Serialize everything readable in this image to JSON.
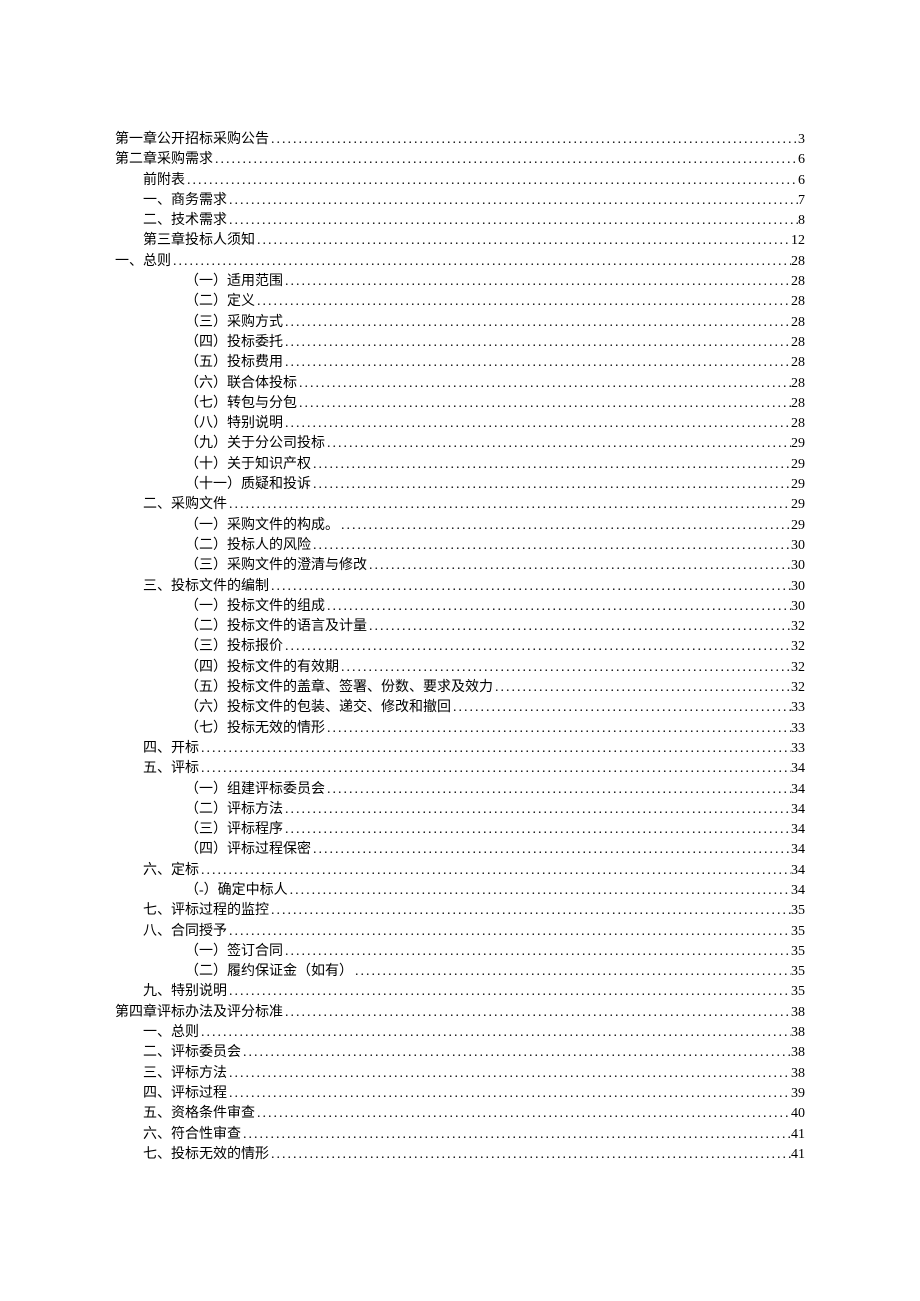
{
  "toc": [
    {
      "label": "第一章公开招标采购公告",
      "page": "3",
      "indent": 0
    },
    {
      "label": "第二章采购需求",
      "page": "6",
      "indent": 0
    },
    {
      "label": "前附表",
      "page": "6",
      "indent": 1
    },
    {
      "label": "一、商务需求",
      "page": "7",
      "indent": 1
    },
    {
      "label": "二、技术需求",
      "page": "8",
      "indent": 1
    },
    {
      "label": "第三章投标人须知",
      "page": "12",
      "indent": 1
    },
    {
      "label": "一、总则",
      "page": "28",
      "indent": 0
    },
    {
      "label": "（一）适用范围",
      "page": "28",
      "indent": 2
    },
    {
      "label": "（二）定义",
      "page": "28",
      "indent": 2
    },
    {
      "label": "（三）采购方式",
      "page": "28",
      "indent": 2
    },
    {
      "label": "（四）投标委托",
      "page": "28",
      "indent": 2
    },
    {
      "label": "（五）投标费用",
      "page": "28",
      "indent": 2
    },
    {
      "label": "（六）联合体投标",
      "page": "28",
      "indent": 2
    },
    {
      "label": "（七）转包与分包",
      "page": "28",
      "indent": 2
    },
    {
      "label": "（八）特别说明",
      "page": "28",
      "indent": 2
    },
    {
      "label": "（九）关于分公司投标",
      "page": "29",
      "indent": 2
    },
    {
      "label": "（十）关于知识产权",
      "page": "29",
      "indent": 2
    },
    {
      "label": "（十一）质疑和投诉",
      "page": "29",
      "indent": 2
    },
    {
      "label": "二、采购文件",
      "page": "29",
      "indent": 1
    },
    {
      "label": "（一）采购文件的构成。",
      "page": "29",
      "indent": 2
    },
    {
      "label": "（二）投标人的风险",
      "page": "30",
      "indent": 2
    },
    {
      "label": "（三）采购文件的澄清与修改",
      "page": "30",
      "indent": 2
    },
    {
      "label": "三、投标文件的编制",
      "page": "30",
      "indent": 1
    },
    {
      "label": "（一）投标文件的组成",
      "page": "30",
      "indent": 2
    },
    {
      "label": "（二）投标文件的语言及计量",
      "page": "32",
      "indent": 2
    },
    {
      "label": "（三）投标报价",
      "page": "32",
      "indent": 2
    },
    {
      "label": "（四）投标文件的有效期",
      "page": "32",
      "indent": 2
    },
    {
      "label": "（五）投标文件的盖章、签署、份数、要求及效力",
      "page": "32",
      "indent": 2
    },
    {
      "label": "（六）投标文件的包装、递交、修改和撤回",
      "page": "33",
      "indent": 2
    },
    {
      "label": "（七）投标无效的情形",
      "page": "33",
      "indent": 2
    },
    {
      "label": "四、开标",
      "page": "33",
      "indent": 1
    },
    {
      "label": "五、评标",
      "page": "34",
      "indent": 1
    },
    {
      "label": "（一）组建评标委员会",
      "page": "34",
      "indent": 2
    },
    {
      "label": "（二）评标方法",
      "page": "34",
      "indent": 2
    },
    {
      "label": "（三）评标程序",
      "page": "34",
      "indent": 2
    },
    {
      "label": "（四）评标过程保密",
      "page": "34",
      "indent": 2
    },
    {
      "label": "六、定标",
      "page": "34",
      "indent": 1
    },
    {
      "label": "（-）确定中标人",
      "page": "34",
      "indent": 2
    },
    {
      "label": "七、评标过程的监控",
      "page": "35",
      "indent": 1
    },
    {
      "label": "八、合同授予",
      "page": "35",
      "indent": 1
    },
    {
      "label": "（一）签订合同",
      "page": "35",
      "indent": 2
    },
    {
      "label": "（二）履约保证金（如有）",
      "page": "35",
      "indent": 2
    },
    {
      "label": "九、特别说明",
      "page": "35",
      "indent": 1
    },
    {
      "label": "第四章评标办法及评分标准",
      "page": "38",
      "indent": 0
    },
    {
      "label": "一、总则",
      "page": "38",
      "indent": 1
    },
    {
      "label": "二、评标委员会",
      "page": "38",
      "indent": 1
    },
    {
      "label": "三、评标方法",
      "page": "38",
      "indent": 1
    },
    {
      "label": "四、评标过程",
      "page": "39",
      "indent": 1
    },
    {
      "label": "五、资格条件审查",
      "page": "40",
      "indent": 1
    },
    {
      "label": "六、符合性审查",
      "page": "41",
      "indent": 1
    },
    {
      "label": "七、投标无效的情形",
      "page": "41",
      "indent": 1
    }
  ]
}
